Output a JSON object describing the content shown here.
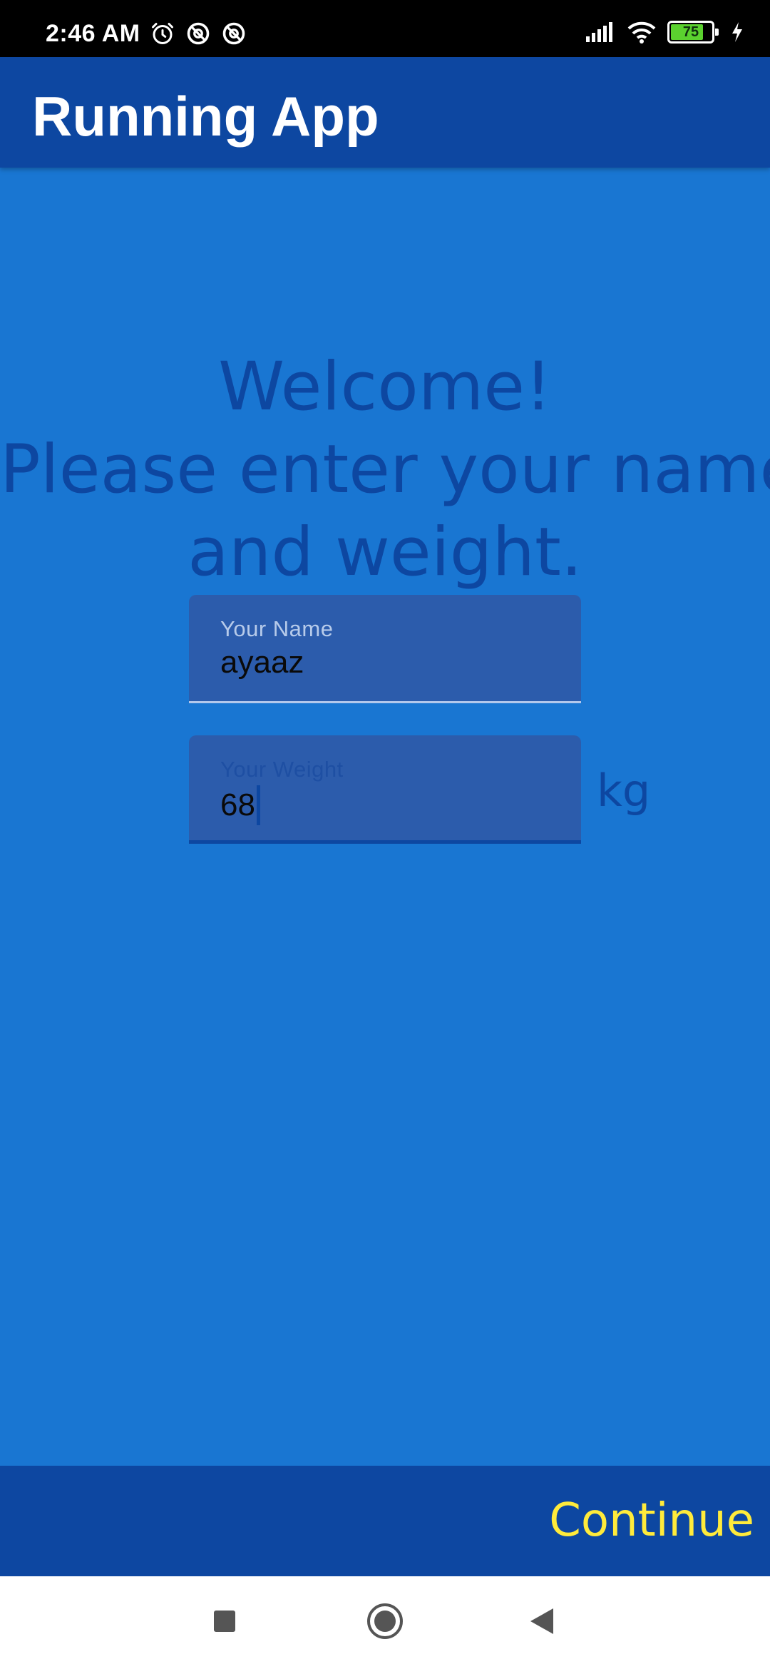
{
  "status_bar": {
    "time": "2:46 AM",
    "left_icons": [
      "alarm-icon",
      "data-saver-icon",
      "data-saver-icon"
    ],
    "right_icons": [
      "signal-icon",
      "wifi-icon",
      "battery-icon",
      "charging-icon"
    ],
    "battery_level": "75"
  },
  "app_bar": {
    "title": "Running App"
  },
  "main": {
    "welcome_lines": [
      "Welcome!",
      "Please enter your name",
      "and weight."
    ],
    "name_field": {
      "label": "Your Name",
      "value": "ayaaz"
    },
    "weight_field": {
      "label": "Your Weight",
      "value": "68",
      "unit": "kg"
    }
  },
  "bottom_bar": {
    "continue_label": "Continue"
  },
  "nav_bar": {
    "buttons": [
      "recent-apps",
      "home",
      "back"
    ]
  },
  "colors": {
    "app_bar": "#0d47a1",
    "background": "#1976d2",
    "field_background": "#2c5cac",
    "accent_text": "#ffeb3b",
    "battery_green": "#5bd22f"
  }
}
